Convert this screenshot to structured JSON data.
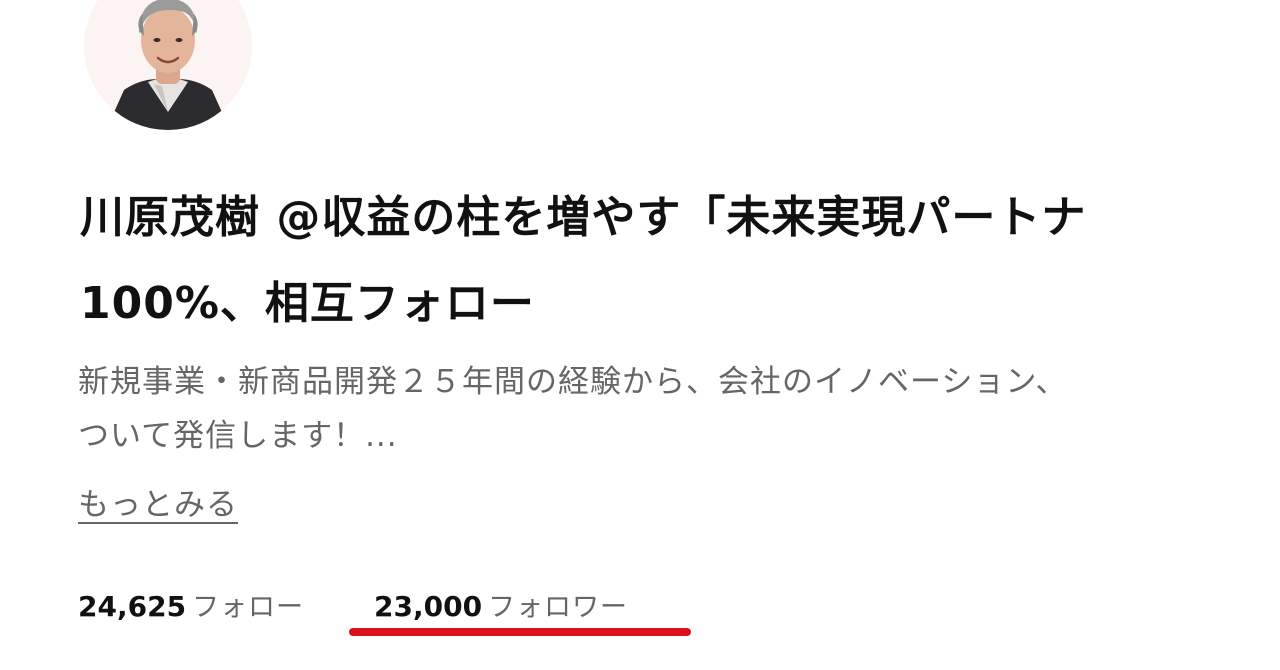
{
  "profile": {
    "name_line1": "川原茂樹 @収益の柱を増やす「未来実現パートナ",
    "name_line2": "100%、相互フォロー",
    "bio_line1": "新規事業・新商品開発２５年間の経験から、会社のイノベーション、",
    "bio_line2": "ついて発信します！...",
    "more_label": "もっとみる",
    "avatar_icon": "user-photo",
    "avatar_bg": "#fbf4f2"
  },
  "stats": {
    "follow_count": "24,625",
    "follow_label": "フォロー",
    "follower_count": "23,000",
    "follower_label": "フォロワー"
  },
  "colors": {
    "highlight": "#d8111b",
    "text_primary": "#111111",
    "text_secondary": "#666666"
  }
}
